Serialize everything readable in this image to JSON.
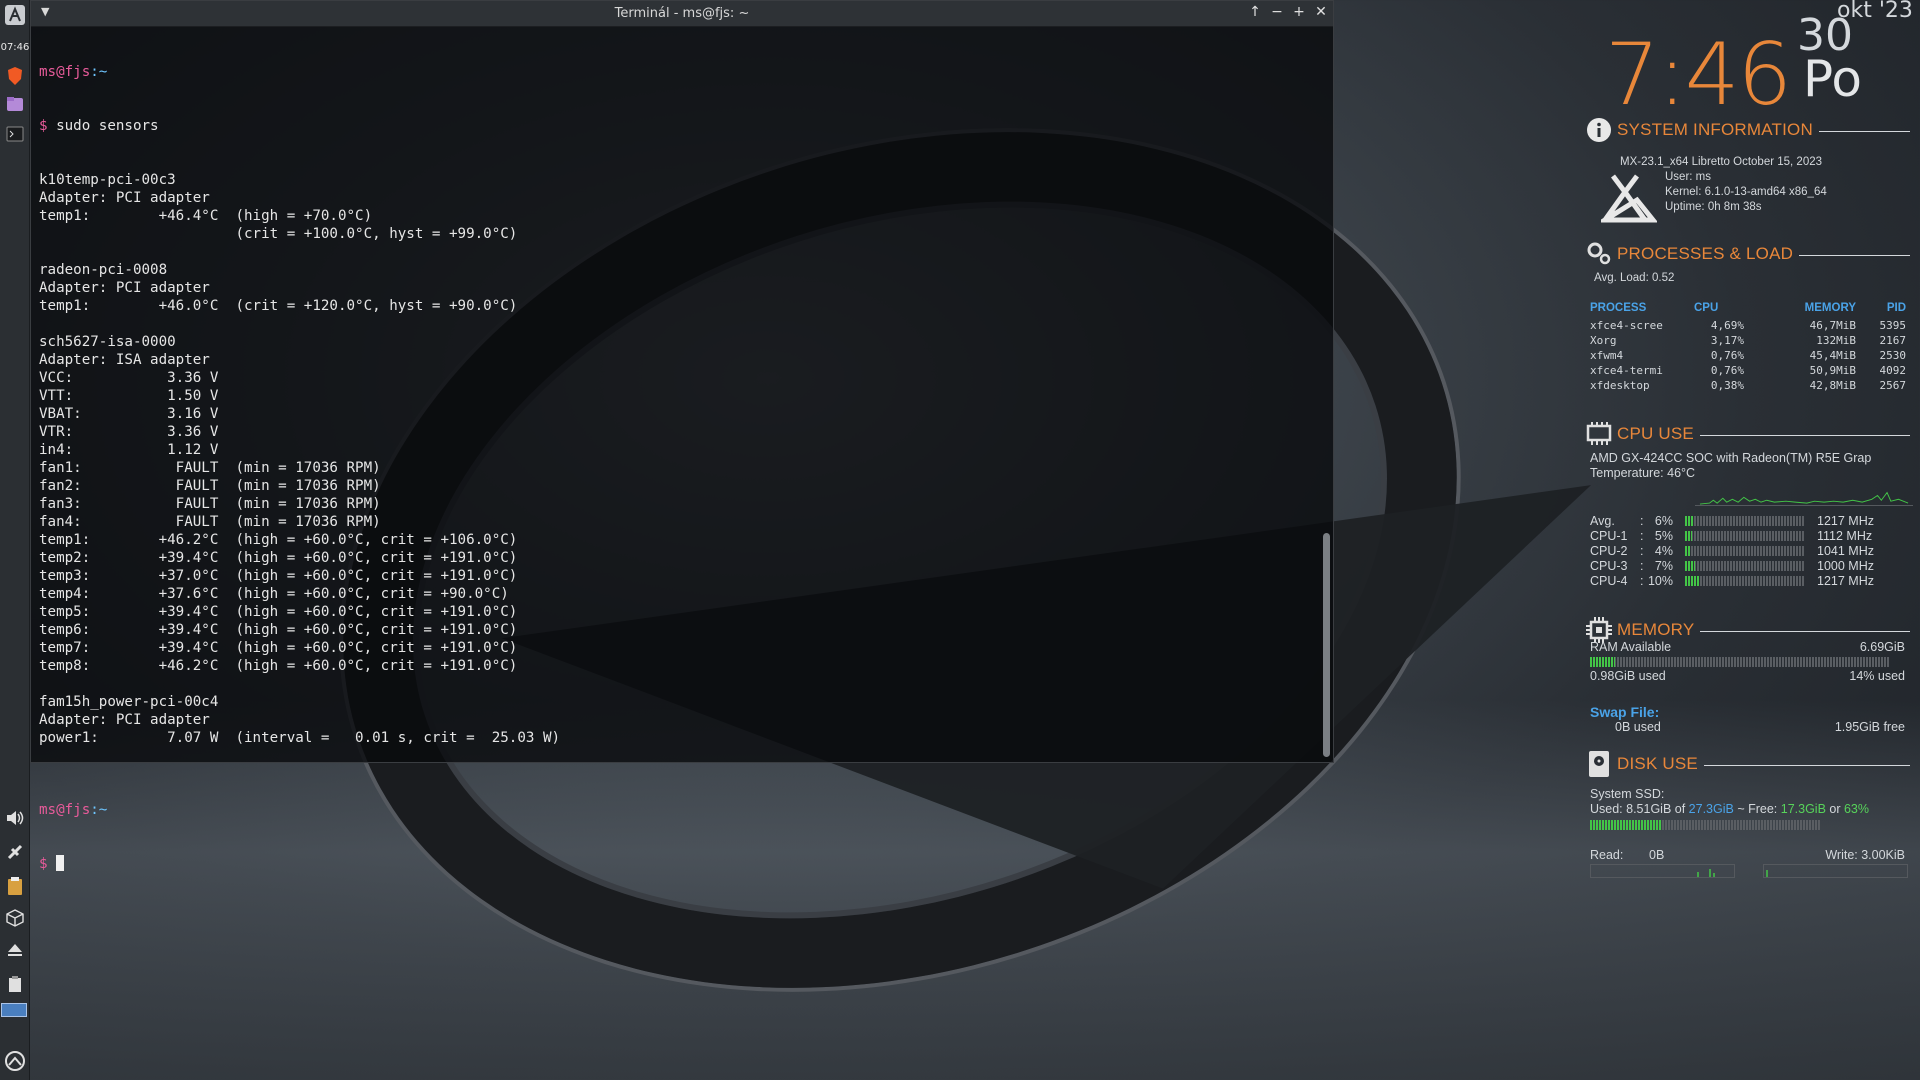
{
  "left_panel": {
    "clock": "07:46"
  },
  "terminal": {
    "title": "Terminál - ms@fjs: ~",
    "prompt_user": "ms@fjs",
    "prompt_sep": ":~",
    "prompt_symbol": "$",
    "command": " sudo sensors",
    "lines": [
      "k10temp-pci-00c3",
      "Adapter: PCI adapter",
      "temp1:        +46.4°C  (high = +70.0°C)",
      "                       (crit = +100.0°C, hyst = +99.0°C)",
      "",
      "radeon-pci-0008",
      "Adapter: PCI adapter",
      "temp1:        +46.0°C  (crit = +120.0°C, hyst = +90.0°C)",
      "",
      "sch5627-isa-0000",
      "Adapter: ISA adapter",
      "VCC:           3.36 V",
      "VTT:           1.50 V",
      "VBAT:          3.16 V",
      "VTR:           3.36 V",
      "in4:           1.12 V",
      "fan1:           FAULT  (min = 17036 RPM)",
      "fan2:           FAULT  (min = 17036 RPM)",
      "fan3:           FAULT  (min = 17036 RPM)",
      "fan4:           FAULT  (min = 17036 RPM)",
      "temp1:        +46.2°C  (high = +60.0°C, crit = +106.0°C)",
      "temp2:        +39.4°C  (high = +60.0°C, crit = +191.0°C)",
      "temp3:        +37.0°C  (high = +60.0°C, crit = +191.0°C)",
      "temp4:        +37.6°C  (high = +60.0°C, crit = +90.0°C)",
      "temp5:        +39.4°C  (high = +60.0°C, crit = +191.0°C)",
      "temp6:        +39.4°C  (high = +60.0°C, crit = +191.0°C)",
      "temp7:        +39.4°C  (high = +60.0°C, crit = +191.0°C)",
      "temp8:        +46.2°C  (high = +60.0°C, crit = +191.0°C)",
      "",
      "fam15h_power-pci-00c4",
      "Adapter: PCI adapter",
      "power1:        7.07 W  (interval =   0.01 s, crit =  25.03 W)",
      ""
    ]
  },
  "conky": {
    "time": "7:46",
    "day_number": "30",
    "month": "okt '23",
    "weekday": "Po",
    "system_info": {
      "title": "SYSTEM INFORMATION",
      "distro": "MX-23.1_x64 Libretto October 15, 2023",
      "user": "User: ms",
      "kernel": "Kernel: 6.1.0-13-amd64 x86_64",
      "uptime": "Uptime: 0h 8m 38s"
    },
    "processes": {
      "title": "PROCESSES & LOAD",
      "avg_load": "Avg. Load: 0.52",
      "headers": {
        "process": "PROCESS",
        "cpu": "CPU",
        "memory": "MEMORY",
        "pid": "PID"
      },
      "rows": [
        {
          "name": "xfce4-scree",
          "cpu": "4,69%",
          "mem": "46,7MiB",
          "pid": "5395"
        },
        {
          "name": "Xorg",
          "cpu": "3,17%",
          "mem": "132MiB",
          "pid": "2167"
        },
        {
          "name": "xfwm4",
          "cpu": "0,76%",
          "mem": "45,4MiB",
          "pid": "2530"
        },
        {
          "name": "xfce4-termi",
          "cpu": "0,76%",
          "mem": "50,9MiB",
          "pid": "4092"
        },
        {
          "name": "xfdesktop",
          "cpu": "0,38%",
          "mem": "42,8MiB",
          "pid": "2567"
        }
      ]
    },
    "cpu": {
      "title": "CPU USE",
      "model": "AMD GX-424CC SOC with Radeon(TM) R5E Grap",
      "temperature": "Temperature: 46°C",
      "rows": [
        {
          "label": "Avg.",
          "pct": "6%",
          "level": 0.06,
          "freq": "1217 MHz"
        },
        {
          "label": "CPU-1",
          "pct": "5%",
          "level": 0.05,
          "freq": "1112 MHz"
        },
        {
          "label": "CPU-2",
          "pct": "4%",
          "level": 0.04,
          "freq": "1041 MHz"
        },
        {
          "label": "CPU-3",
          "pct": "7%",
          "level": 0.07,
          "freq": "1000 MHz"
        },
        {
          "label": "CPU-4",
          "pct": "10%",
          "level": 0.1,
          "freq": "1217 MHz"
        }
      ]
    },
    "memory": {
      "title": "MEMORY",
      "ram_label": "RAM Available",
      "ram_available": "6.69GiB",
      "ram_used": "0.98GiB used",
      "ram_pct": "14% used",
      "ram_level": 0.14,
      "swap_label": "Swap File:",
      "swap_used": "0B used",
      "swap_free": "1.95GiB free"
    },
    "disk": {
      "title": "DISK USE",
      "label": "System SSD:",
      "used_prefix": "Used: 8.51GiB of ",
      "total": "27.3GiB",
      "free_prefix": " ~ Free: ",
      "free": "17.3GiB",
      "or": " or ",
      "free_pct": "63%",
      "used_level": 0.31,
      "read_label": "Read:",
      "read_value": "0B",
      "write_label": "Write: 3.00KiB"
    },
    "colors": {
      "accent": "#e8873a",
      "header_blue": "#4aa3e8",
      "bar_green": "#43c547"
    }
  }
}
